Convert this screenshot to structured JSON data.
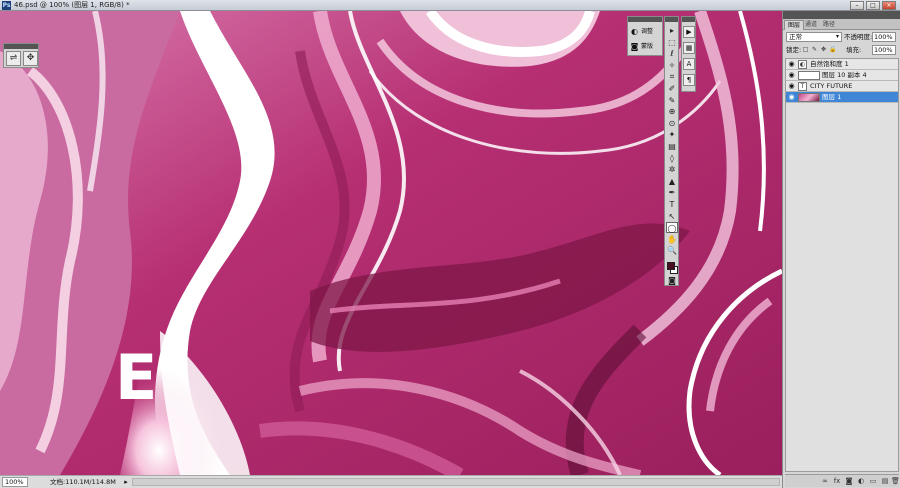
{
  "window": {
    "app_icon_label": "Ps",
    "title": "46.psd @ 100% (图层 1, RGB/8) *",
    "controls": [
      "–",
      "□",
      "×"
    ]
  },
  "canvas": {
    "overlay_letter": "E"
  },
  "status": {
    "zoom": "100%",
    "doc_info": "文档:110.1M/114.8M",
    "arrow": "▸"
  },
  "adjust_panel": {
    "items": [
      {
        "icon": "adjust-icon",
        "glyph": "◐",
        "label": "调整"
      },
      {
        "icon": "mask-icon",
        "glyph": "◙",
        "label": "蒙版"
      }
    ]
  },
  "tools": [
    "▸",
    "⬚",
    "ℓ",
    "✧",
    "⌗",
    "✐",
    "✎",
    "⊕",
    "⊙",
    "✦",
    "▤",
    "◊",
    "✲",
    "▲",
    "✒",
    "T",
    "↖",
    "◯",
    "✋",
    "🔍"
  ],
  "tool_names": [
    "move-tool-icon",
    "marquee-tool-icon",
    "lasso-tool-icon",
    "quick-select-tool-icon",
    "crop-tool-icon",
    "eyedropper-tool-icon",
    "healing-brush-tool-icon",
    "brush-tool-icon",
    "clone-stamp-tool-icon",
    "history-brush-tool-icon",
    "eraser-tool-icon",
    "gradient-tool-icon",
    "blur-tool-icon",
    "dodge-tool-icon",
    "pen-tool-icon",
    "type-tool-icon",
    "path-select-tool-icon",
    "shape-tool-icon",
    "hand-tool-icon",
    "zoom-tool-icon"
  ],
  "active_tool_index": 17,
  "dock_icons": [
    "▶",
    "▦",
    "A",
    "¶"
  ],
  "layers_panel": {
    "tabs": [
      "图层",
      "通道",
      "路径"
    ],
    "blend_mode": "正常",
    "opacity_label": "不透明度:",
    "opacity_value": "100%",
    "lock_label": "锁定:",
    "lock_icons": [
      "□",
      "✎",
      "✥",
      "🔒"
    ],
    "fill_label": "填充:",
    "fill_value": "100%",
    "layers": [
      {
        "name": "自然饱和度 1",
        "thumb_glyph": "◐",
        "kind": "adj",
        "selected": false
      },
      {
        "name": "图层 10 副本 4",
        "thumb_glyph": "",
        "kind": "blank",
        "selected": false
      },
      {
        "name": "CITY FUTURE",
        "thumb_glyph": "T",
        "kind": "text",
        "selected": false
      },
      {
        "name": "图层 1",
        "thumb_glyph": "",
        "kind": "img",
        "selected": true
      }
    ],
    "footer_icons": [
      "∞",
      "fx",
      "◙",
      "◐",
      "▭",
      "▤",
      "🗑"
    ]
  },
  "colors": {
    "foreground": "#4a0f22",
    "background": "#ffffff",
    "selection": "#3f86d6"
  }
}
